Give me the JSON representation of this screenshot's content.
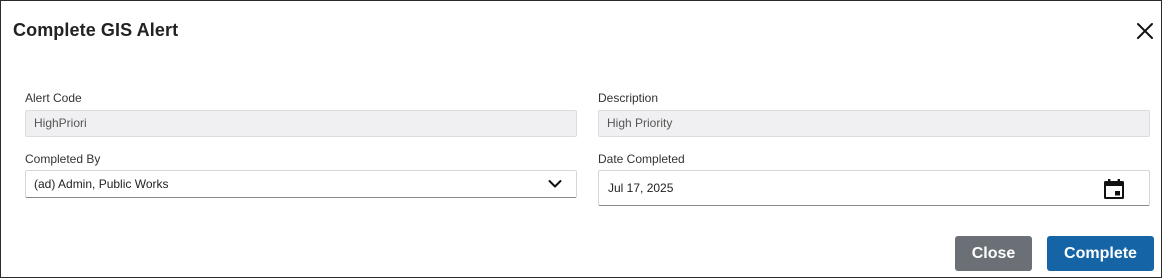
{
  "dialog": {
    "title": "Complete GIS Alert"
  },
  "fields": {
    "alert_code": {
      "label": "Alert Code",
      "value": "HighPriori"
    },
    "description": {
      "label": "Description",
      "value": "High Priority"
    },
    "completed_by": {
      "label": "Completed By",
      "value": "(ad) Admin, Public Works"
    },
    "date_completed": {
      "label": "Date Completed",
      "value": "Jul 17, 2025"
    }
  },
  "buttons": {
    "close_label": "Close",
    "complete_label": "Complete"
  },
  "icons": {
    "close": "close-icon",
    "dropdown": "chevron-down-icon",
    "calendar": "calendar-icon"
  },
  "colors": {
    "close_button": "#6b6f76",
    "complete_button": "#1565a6",
    "readonly_bg": "#f0f0f2"
  }
}
